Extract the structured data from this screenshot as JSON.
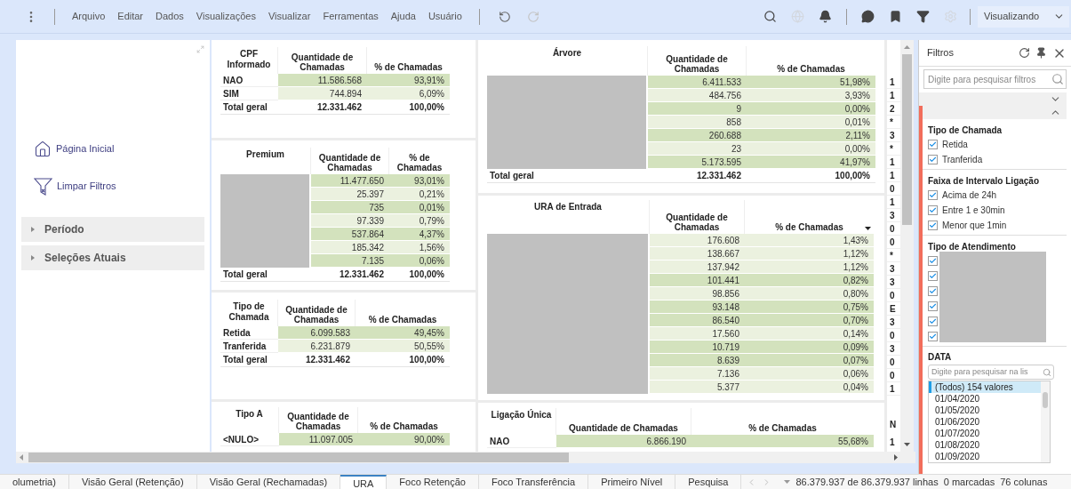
{
  "toolbar": {
    "menus": [
      "Arquivo",
      "Editar",
      "Dados",
      "Visualizações",
      "Visualizar",
      "Ferramentas",
      "Ajuda",
      "Usuário"
    ],
    "history_icons": [
      {
        "kind": "undo",
        "disabled": false
      },
      {
        "kind": "redo",
        "disabled": true
      }
    ],
    "right_icons": [
      {
        "kind": "search",
        "disabled": false
      },
      {
        "kind": "globe",
        "disabled": true
      },
      {
        "kind": "bell",
        "disabled": false
      },
      {
        "kind": "divider"
      },
      {
        "kind": "chat",
        "disabled": false
      },
      {
        "kind": "bookmark",
        "disabled": false
      },
      {
        "kind": "filter",
        "disabled": false
      },
      {
        "kind": "gear",
        "disabled": true
      }
    ],
    "mode": "Visualizando"
  },
  "left_panel": {
    "links": [
      {
        "kind": "home",
        "label": "Página Inicial"
      },
      {
        "kind": "clear-filter",
        "label": "Limpar Filtros"
      }
    ],
    "sections": [
      {
        "label": "Período",
        "expanded": false
      },
      {
        "label": "Seleções Atuais",
        "expanded": false
      }
    ]
  },
  "tables_left": [
    {
      "title": "CPF Informado",
      "labels_hidden": false,
      "columns": [
        "Quantidade de Chamadas",
        "% de Chamadas"
      ],
      "sortable": false,
      "rows": [
        {
          "label": "NAO",
          "qty": "11.586.568",
          "pct": "93,91%",
          "highlighted": true
        },
        {
          "label": "SIM",
          "qty": "744.894",
          "pct": "6,09%",
          "highlighted": false
        }
      ],
      "total": {
        "label": "Total geral",
        "qty": "12.331.462",
        "pct": "100,00%"
      }
    },
    {
      "title": "Premium",
      "labels_hidden": true,
      "columns": [
        "Quantidade de Chamadas",
        "% de Chamadas"
      ],
      "sortable": false,
      "rows": [
        {
          "qty": "11.477.650",
          "pct": "93,01%",
          "highlighted": true
        },
        {
          "qty": "25.397",
          "pct": "0,21%",
          "highlighted": false
        },
        {
          "qty": "735",
          "pct": "0,01%",
          "highlighted": true
        },
        {
          "qty": "97.339",
          "pct": "0,79%",
          "highlighted": false
        },
        {
          "qty": "537.864",
          "pct": "4,37%",
          "highlighted": true
        },
        {
          "qty": "185.342",
          "pct": "1,56%",
          "highlighted": false
        },
        {
          "qty": "7.135",
          "pct": "0,06%",
          "highlighted": true
        }
      ],
      "total": {
        "label": "Total geral",
        "qty": "12.331.462",
        "pct": "100,00%"
      }
    },
    {
      "title": "Tipo de Chamada",
      "labels_hidden": false,
      "columns": [
        "Quantidade de Chamadas",
        "% de Chamadas"
      ],
      "sortable": false,
      "rows": [
        {
          "label": "Retida",
          "qty": "6.099.583",
          "pct": "49,45%",
          "highlighted": true
        },
        {
          "label": "Tranferida",
          "qty": "6.231.879",
          "pct": "50,55%",
          "highlighted": false
        }
      ],
      "total": {
        "label": "Total geral",
        "qty": "12.331.462",
        "pct": "100,00%"
      }
    },
    {
      "title": "Tipo A",
      "labels_hidden": false,
      "columns": [
        "Quantidade de Chamadas",
        "% de Chamadas"
      ],
      "sortable": false,
      "rows": [
        {
          "label": "<NULO>",
          "qty": "11.097.005",
          "pct": "90,00%",
          "highlighted": true
        }
      ]
    }
  ],
  "tables_right": [
    {
      "title": "Árvore",
      "labels_hidden": true,
      "columns": [
        "Quantidade de Chamadas",
        "% de Chamadas"
      ],
      "sortable": false,
      "rows": [
        {
          "qty": "6.411.533",
          "pct": "51,98%",
          "highlighted": true
        },
        {
          "qty": "484.756",
          "pct": "3,93%",
          "highlighted": false
        },
        {
          "qty": "9",
          "pct": "0,00%",
          "highlighted": true
        },
        {
          "qty": "858",
          "pct": "0,01%",
          "highlighted": false
        },
        {
          "qty": "260.688",
          "pct": "2,11%",
          "highlighted": true
        },
        {
          "qty": "23",
          "pct": "0,00%",
          "highlighted": false
        },
        {
          "qty": "5.173.595",
          "pct": "41,97%",
          "highlighted": true
        }
      ],
      "total": {
        "label": "Total geral",
        "qty": "12.331.462",
        "pct": "100,00%"
      }
    },
    {
      "title": "URA de Entrada",
      "labels_hidden": true,
      "columns": [
        "Quantidade de Chamadas",
        "% de Chamadas"
      ],
      "sortable": true,
      "rows": [
        {
          "qty": "176.608",
          "pct": "1,43%",
          "highlighted": false
        },
        {
          "qty": "138.667",
          "pct": "1,12%",
          "highlighted": false
        },
        {
          "qty": "137.942",
          "pct": "1,12%",
          "highlighted": false
        },
        {
          "qty": "101.441",
          "pct": "0,82%",
          "highlighted": true
        },
        {
          "qty": "98.856",
          "pct": "0,80%",
          "highlighted": false
        },
        {
          "qty": "93.148",
          "pct": "0,75%",
          "highlighted": true
        },
        {
          "qty": "86.540",
          "pct": "0,70%",
          "highlighted": true
        },
        {
          "qty": "17.560",
          "pct": "0,14%",
          "highlighted": false
        },
        {
          "qty": "10.719",
          "pct": "0,09%",
          "highlighted": true
        },
        {
          "qty": "8.639",
          "pct": "0,07%",
          "highlighted": true
        },
        {
          "qty": "7.136",
          "pct": "0,06%",
          "highlighted": false
        },
        {
          "qty": "5.377",
          "pct": "0,04%",
          "highlighted": false
        }
      ]
    },
    {
      "title": "Ligação Única",
      "labels_hidden": false,
      "columns": [
        "Quantidade de Chamadas",
        "% de Chamadas"
      ],
      "sortable": false,
      "rows": [
        {
          "label": "NAO",
          "qty": "6.866.190",
          "pct": "55,68%",
          "highlighted": true
        }
      ]
    }
  ],
  "clipped_column": {
    "cells": [
      "1",
      "1",
      "2",
      "*",
      "3",
      "*",
      "1",
      "1",
      "0",
      "1",
      "3",
      "0",
      "0",
      "*",
      "3",
      "3",
      "0",
      "E",
      "3",
      "0",
      "3",
      "0",
      "0",
      "1"
    ],
    "bottom_cells": [
      "N",
      "1"
    ]
  },
  "filters": {
    "title": "Filtros",
    "search_placeholder": "Digite para pesquisar filtros",
    "groups": [
      {
        "title": "Tipo de Chamada",
        "labels_hidden": false,
        "items": [
          {
            "label": "Retida",
            "checked": true
          },
          {
            "label": "Tranferida",
            "checked": true
          }
        ]
      },
      {
        "title": "Faixa de Intervalo Ligação",
        "labels_hidden": false,
        "items": [
          {
            "label": "Acima de 24h",
            "checked": true
          },
          {
            "label": "Entre 1 e 30min",
            "checked": true
          },
          {
            "label": "Menor que 1min",
            "checked": true
          }
        ]
      },
      {
        "title": "Tipo de Atendimento",
        "labels_hidden": true,
        "items": [
          {
            "checked": true
          },
          {
            "checked": true
          },
          {
            "checked": true
          },
          {
            "checked": true
          },
          {
            "checked": true
          },
          {
            "checked": true
          }
        ]
      }
    ],
    "date": {
      "title": "DATA",
      "placeholder": "Digite para pesquisar na lis",
      "values": [
        {
          "label": "(Todos) 154 valores",
          "selected": true
        },
        {
          "label": "01/04/2020",
          "selected": false
        },
        {
          "label": "01/05/2020",
          "selected": false
        },
        {
          "label": "01/06/2020",
          "selected": false
        },
        {
          "label": "01/07/2020",
          "selected": false
        },
        {
          "label": "01/08/2020",
          "selected": false
        },
        {
          "label": "01/09/2020",
          "selected": false
        }
      ]
    }
  },
  "sheet_tabs": [
    {
      "label": "olumetria)",
      "selected": false
    },
    {
      "label": "Visão Geral (Retenção)",
      "selected": false
    },
    {
      "label": "Visão Geral (Rechamadas)",
      "selected": false
    },
    {
      "label": "URA",
      "selected": true
    },
    {
      "label": "Foco Retenção",
      "selected": false
    },
    {
      "label": "Foco Transferência",
      "selected": false
    },
    {
      "label": "Primeiro Nível",
      "selected": false
    },
    {
      "label": "Pesquisa",
      "selected": false
    }
  ],
  "status": {
    "rows": "86.379.937 de 86.379.937 linhas",
    "marked": "0 marcadas",
    "columns": "76 colunas"
  }
}
